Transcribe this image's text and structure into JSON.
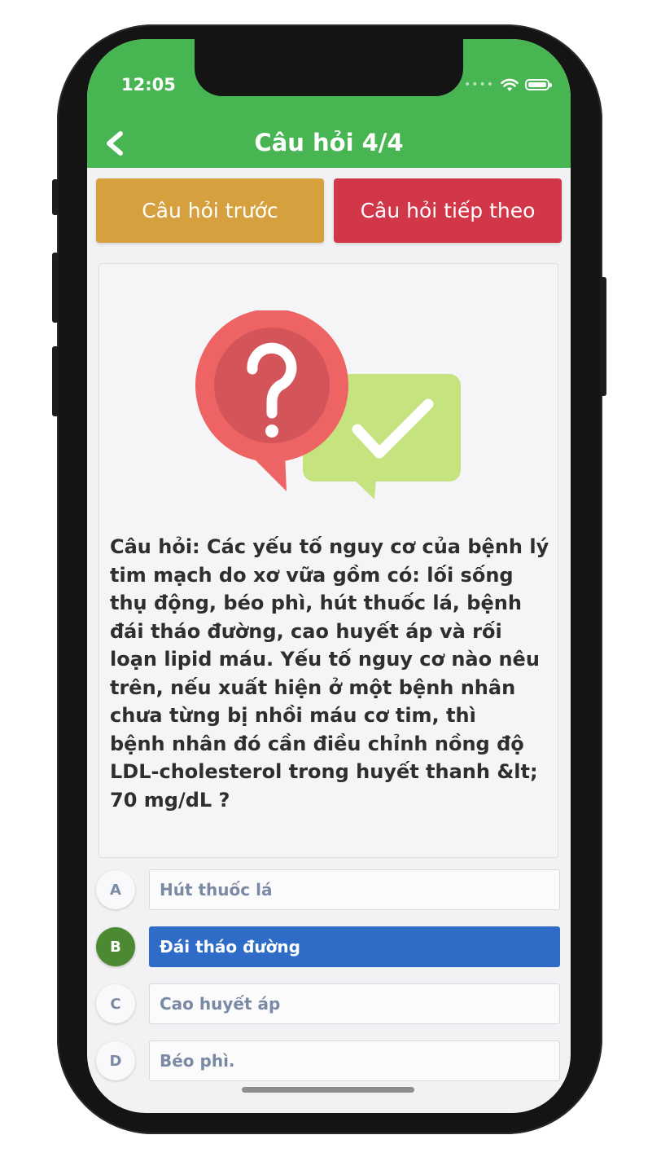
{
  "status": {
    "time": "12:05"
  },
  "header": {
    "title": "Câu hỏi 4/4"
  },
  "nav": {
    "prev_label": "Câu hỏi trước",
    "next_label": "Câu hỏi tiếp theo"
  },
  "question": {
    "text": "Câu hỏi: Các yếu tố nguy cơ của bệnh lý tim mạch do xơ vữa gồm có: lối sống thụ động, béo phì, hút thuốc lá, bệnh đái tháo đường, cao huyết áp và rối loạn lipid máu. Yếu tố nguy cơ nào nêu trên, nếu xuất hiện ở một bệnh nhân chưa từng bị nhồi máu cơ tim, thì\nbệnh nhân đó cần điều chỉnh nồng độ LDL-cholesterol trong huyết thanh &lt; 70 mg/dL ?"
  },
  "options": [
    {
      "letter": "A",
      "text": "Hút thuốc lá",
      "selected": false
    },
    {
      "letter": "B",
      "text": "Đái tháo đường",
      "selected": true
    },
    {
      "letter": "C",
      "text": "Cao huyết áp",
      "selected": false
    },
    {
      "letter": "D",
      "text": "Béo phì.",
      "selected": false
    }
  ],
  "colors": {
    "header": "#48b553",
    "prev_button": "#d5a03d",
    "next_button": "#d13748",
    "selected_option": "#2e6cc8",
    "selected_letter": "#4b8a32"
  },
  "icons": {
    "back": "chevron-left-icon",
    "illustration": "question-answer-icon",
    "wifi": "wifi-icon",
    "battery": "battery-icon"
  }
}
